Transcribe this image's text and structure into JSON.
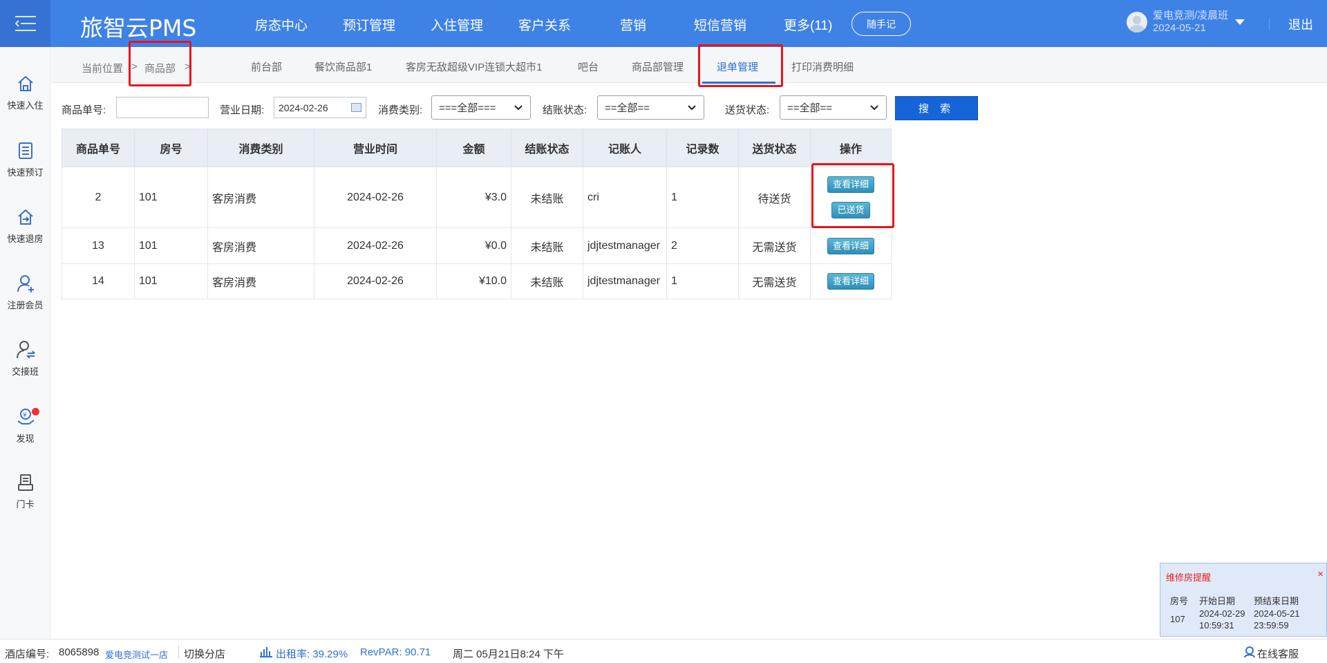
{
  "app": {
    "brand": "旅智云PMS",
    "nav": [
      "房态中心",
      "预订管理",
      "入住管理",
      "客户关系",
      "营销",
      "短信营销",
      "更多(11)"
    ],
    "note_button": "随手记",
    "user_line1": "爱电竞测/凌晨班",
    "user_line2": "2024-05-21",
    "logout": "退出"
  },
  "sidebar": [
    {
      "label": "快速入住",
      "icon": "home-icon"
    },
    {
      "label": "快速预订",
      "icon": "booking-list-icon"
    },
    {
      "label": "快速退房",
      "icon": "checkout-icon"
    },
    {
      "label": "注册会员",
      "icon": "add-user-icon"
    },
    {
      "label": "交接班",
      "icon": "shift-handover-icon"
    },
    {
      "label": "发现",
      "icon": "discover-icon"
    },
    {
      "label": "门卡",
      "icon": "door-card-icon"
    }
  ],
  "breadcrumb": {
    "prefix": "当前位置",
    "sep1": ">",
    "current": "商品部",
    "sep2": ">"
  },
  "tabs": [
    "前台部",
    "餐饮商品部1",
    "客房无敌超级VIP连锁大超市1",
    "吧台",
    "商品部管理",
    "退单管理",
    "打印消费明细"
  ],
  "active_tab": "退单管理",
  "filters": {
    "order_no_label": "商品单号:",
    "order_no_value": "",
    "date_label": "营业日期:",
    "date_value": "2024-02-26",
    "type_label": "消费类别:",
    "type_value": "===全部===",
    "settle_label": "结账状态:",
    "settle_value": "==全部==",
    "delivery_label": "送货状态:",
    "delivery_value": "==全部==",
    "search_button": "搜 索"
  },
  "table": {
    "headers": [
      "商品单号",
      "房号",
      "消费类别",
      "营业时间",
      "金额",
      "结账状态",
      "记账人",
      "记录数",
      "送货状态",
      "操作"
    ],
    "rows": [
      {
        "no": "2",
        "room": "101",
        "type": "客房消费",
        "date": "2024-02-26",
        "amount": "¥3.0",
        "settle": "未结账",
        "operator": "cri",
        "count": "1",
        "delivery": "待送货",
        "btn1": "查看详细",
        "btn2": "已送货"
      },
      {
        "no": "13",
        "room": "101",
        "type": "客房消费",
        "date": "2024-02-26",
        "amount": "¥0.0",
        "settle": "未结账",
        "operator": "jdjtestmanager",
        "count": "2",
        "delivery": "无需送货",
        "btn1": "查看详细"
      },
      {
        "no": "14",
        "room": "101",
        "type": "客房消费",
        "date": "2024-02-26",
        "amount": "¥10.0",
        "settle": "未结账",
        "operator": "jdjtestmanager",
        "count": "1",
        "delivery": "无需送货",
        "btn1": "查看详细"
      }
    ]
  },
  "status": {
    "hotel_no_label": "酒店编号:",
    "hotel_no": "8065898",
    "hotel_name": "爱电竞测试一店",
    "switch_branch": "切换分店",
    "occupancy": "出租率: 39.29%",
    "revpar": "RevPAR: 90.71",
    "datetime": "周二 05月21日8:24 下午",
    "online_service": "在线客服"
  },
  "repair_panel": {
    "title": "维修房提醒",
    "close": "×",
    "col_room": "房号",
    "col_start": "开始日期",
    "col_end": "预结束日期",
    "room": "107",
    "start_date": "2024-02-29",
    "start_time": "10:59:31",
    "end_date": "2024-05-21",
    "end_time": "23:59:59"
  },
  "colors": {
    "topbar": "#3f82e6",
    "accent": "#2d6fd8",
    "highlight_box": "#e8131a",
    "op_button": "#3a9cc3"
  }
}
